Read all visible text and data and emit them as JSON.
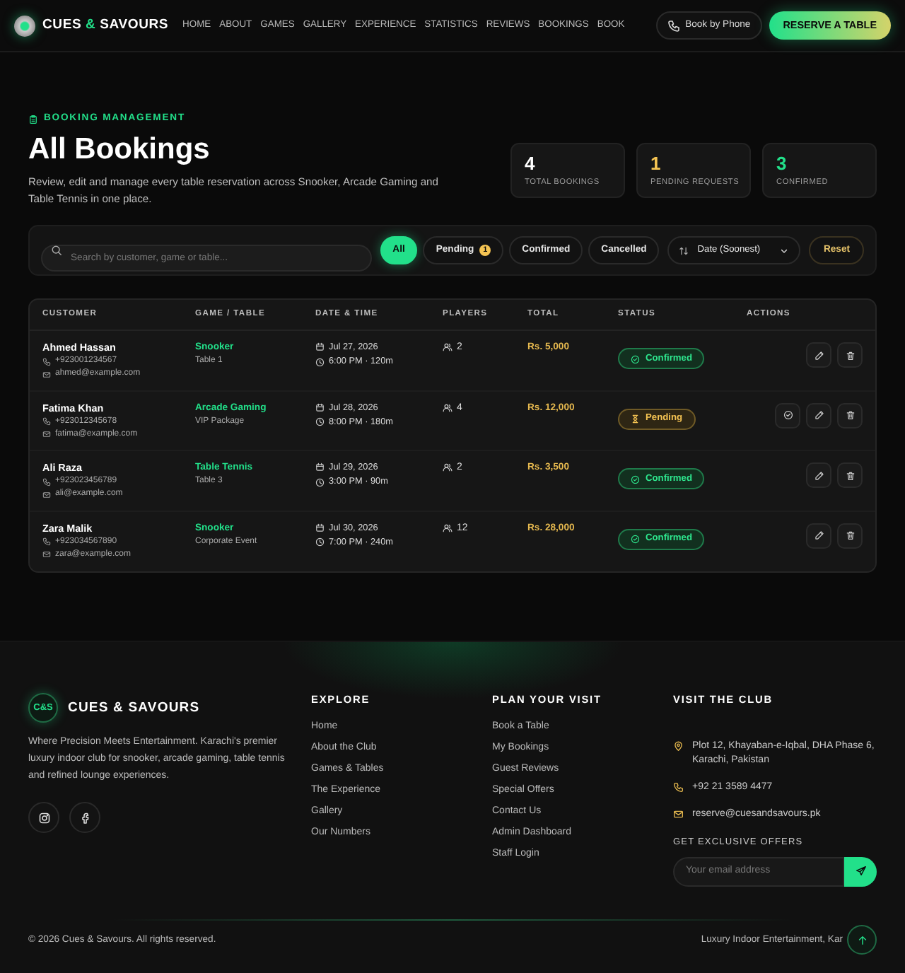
{
  "nav": {
    "brand": {
      "name_start": "CUES",
      "amp": "&",
      "name_end": "SAVOURS"
    },
    "links": [
      {
        "label": "HOME"
      },
      {
        "label": "ABOUT"
      },
      {
        "label": "GAMES"
      },
      {
        "label": "GALLERY"
      },
      {
        "label": "EXPERIENCE"
      },
      {
        "label": "STATISTICS"
      },
      {
        "label": "REVIEWS"
      },
      {
        "label": "BOOKINGS"
      },
      {
        "label": "BOOK"
      }
    ],
    "phone_button": "Book by Phone",
    "cta": "RESERVE A TABLE"
  },
  "header": {
    "eyebrow": "BOOKING MANAGEMENT",
    "title": "All Bookings",
    "description": "Review, edit and manage every table reservation across Snooker, Arcade Gaming and Table Tennis in one place.",
    "stats": [
      {
        "value": "4",
        "label": "TOTAL BOOKINGS",
        "color": "#ffffff"
      },
      {
        "value": "1",
        "label": "PENDING REQUESTS",
        "color": "#f5c453"
      },
      {
        "value": "3",
        "label": "CONFIRMED",
        "color": "#22e08a"
      }
    ]
  },
  "filters": {
    "search": {
      "placeholder": "Search by customer, game or table..."
    },
    "chips": [
      {
        "label": "All",
        "selected": true
      },
      {
        "label": "Pending",
        "count": "1",
        "selected": false
      },
      {
        "label": "Confirmed",
        "selected": false
      },
      {
        "label": "Cancelled",
        "selected": false
      }
    ],
    "sort": "Date (Soonest)",
    "reset": "Reset"
  },
  "table": {
    "columns": [
      "CUSTOMER",
      "GAME / TABLE",
      "DATE & TIME",
      "PLAYERS",
      "TOTAL",
      "STATUS",
      "ACTIONS"
    ],
    "rows": [
      {
        "name": "Ahmed Hassan",
        "phone": "+923001234567",
        "email": "ahmed@example.com",
        "game": "Snooker",
        "table": "Table 1",
        "date": "Jul 27, 2026",
        "time": "6:00 PM · 120m",
        "players": "2",
        "total": "Rs. 5,000",
        "status": {
          "kind": "confirmed",
          "label": "Confirmed"
        },
        "actions": [
          {
            "kind": "edit"
          },
          {
            "kind": "delete"
          }
        ]
      },
      {
        "name": "Fatima Khan",
        "phone": "+923012345678",
        "email": "fatima@example.com",
        "game": "Arcade Gaming",
        "table": "VIP Package",
        "date": "Jul 28, 2026",
        "time": "8:00 PM · 180m",
        "players": "4",
        "total": "Rs. 12,000",
        "status": {
          "kind": "pending",
          "label": "Pending"
        },
        "actions": [
          {
            "kind": "confirm"
          },
          {
            "kind": "edit"
          },
          {
            "kind": "delete"
          }
        ]
      },
      {
        "name": "Ali Raza",
        "phone": "+923023456789",
        "email": "ali@example.com",
        "game": "Table Tennis",
        "table": "Table 3",
        "date": "Jul 29, 2026",
        "time": "3:00 PM · 90m",
        "players": "2",
        "total": "Rs. 3,500",
        "status": {
          "kind": "confirmed",
          "label": "Confirmed"
        },
        "actions": [
          {
            "kind": "edit"
          },
          {
            "kind": "delete"
          }
        ]
      },
      {
        "name": "Zara Malik",
        "phone": "+923034567890",
        "email": "zara@example.com",
        "game": "Snooker",
        "table": "Corporate Event",
        "date": "Jul 30, 2026",
        "time": "7:00 PM · 240m",
        "players": "12",
        "total": "Rs. 28,000",
        "status": {
          "kind": "confirmed",
          "label": "Confirmed"
        },
        "actions": [
          {
            "kind": "edit"
          },
          {
            "kind": "delete"
          }
        ]
      }
    ]
  },
  "footer": {
    "logo_mark": "C&S",
    "brand": "CUES & SAVOURS",
    "tagline": "Where Precision Meets Entertainment. Karachi's premier luxury indoor club for snooker, arcade gaming, table tennis and refined lounge experiences.",
    "socials": [
      {
        "kind": "instagram"
      },
      {
        "kind": "facebook"
      }
    ],
    "explore": {
      "title": "EXPLORE",
      "links": [
        "Home",
        "About the Club",
        "Games & Tables",
        "The Experience",
        "Gallery",
        "Our Numbers"
      ]
    },
    "plan": {
      "title": "PLAN YOUR VISIT",
      "links": [
        "Book a Table",
        "My Bookings",
        "Guest Reviews",
        "Special Offers",
        "Contact Us",
        "Admin Dashboard",
        "Staff Login"
      ]
    },
    "visit": {
      "title": "VISIT THE CLUB",
      "contacts": [
        {
          "kind": "address",
          "text": "Plot 12, Khayaban-e-Iqbal, DHA Phase 6, Karachi, Pakistan"
        },
        {
          "kind": "phone",
          "text": "+92 21 3589 4477"
        },
        {
          "kind": "email",
          "text": "reserve@cuesandsavours.pk"
        }
      ],
      "offers_title": "GET EXCLUSIVE OFFERS",
      "email_placeholder": "Your email address"
    },
    "copyright": "© 2026 Cues & Savours. All rights reserved.",
    "tagline_bottom": "Luxury Indoor Entertainment, Kar"
  }
}
